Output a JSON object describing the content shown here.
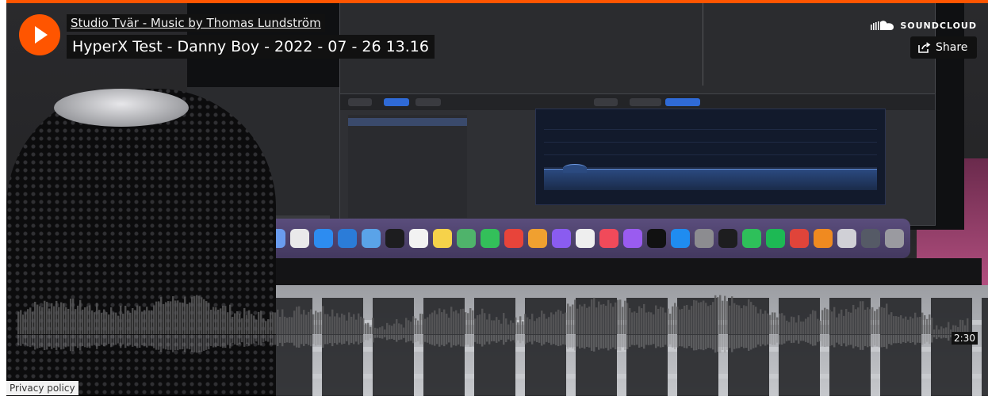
{
  "player": {
    "artist": "Studio Tvär - Music by Thomas Lundström",
    "track_title": "HyperX Test - Danny Boy - 2022 - 07 - 26 13.16",
    "brand": "SOUNDCLOUD",
    "share_label": "Share",
    "duration": "2:30",
    "progress_fraction": 0,
    "accent_color": "#ff5500"
  },
  "footer": {
    "privacy_label": "Privacy policy"
  },
  "icons": {
    "play": "play-icon",
    "soundcloud": "soundcloud-logo-icon",
    "share": "share-icon"
  }
}
